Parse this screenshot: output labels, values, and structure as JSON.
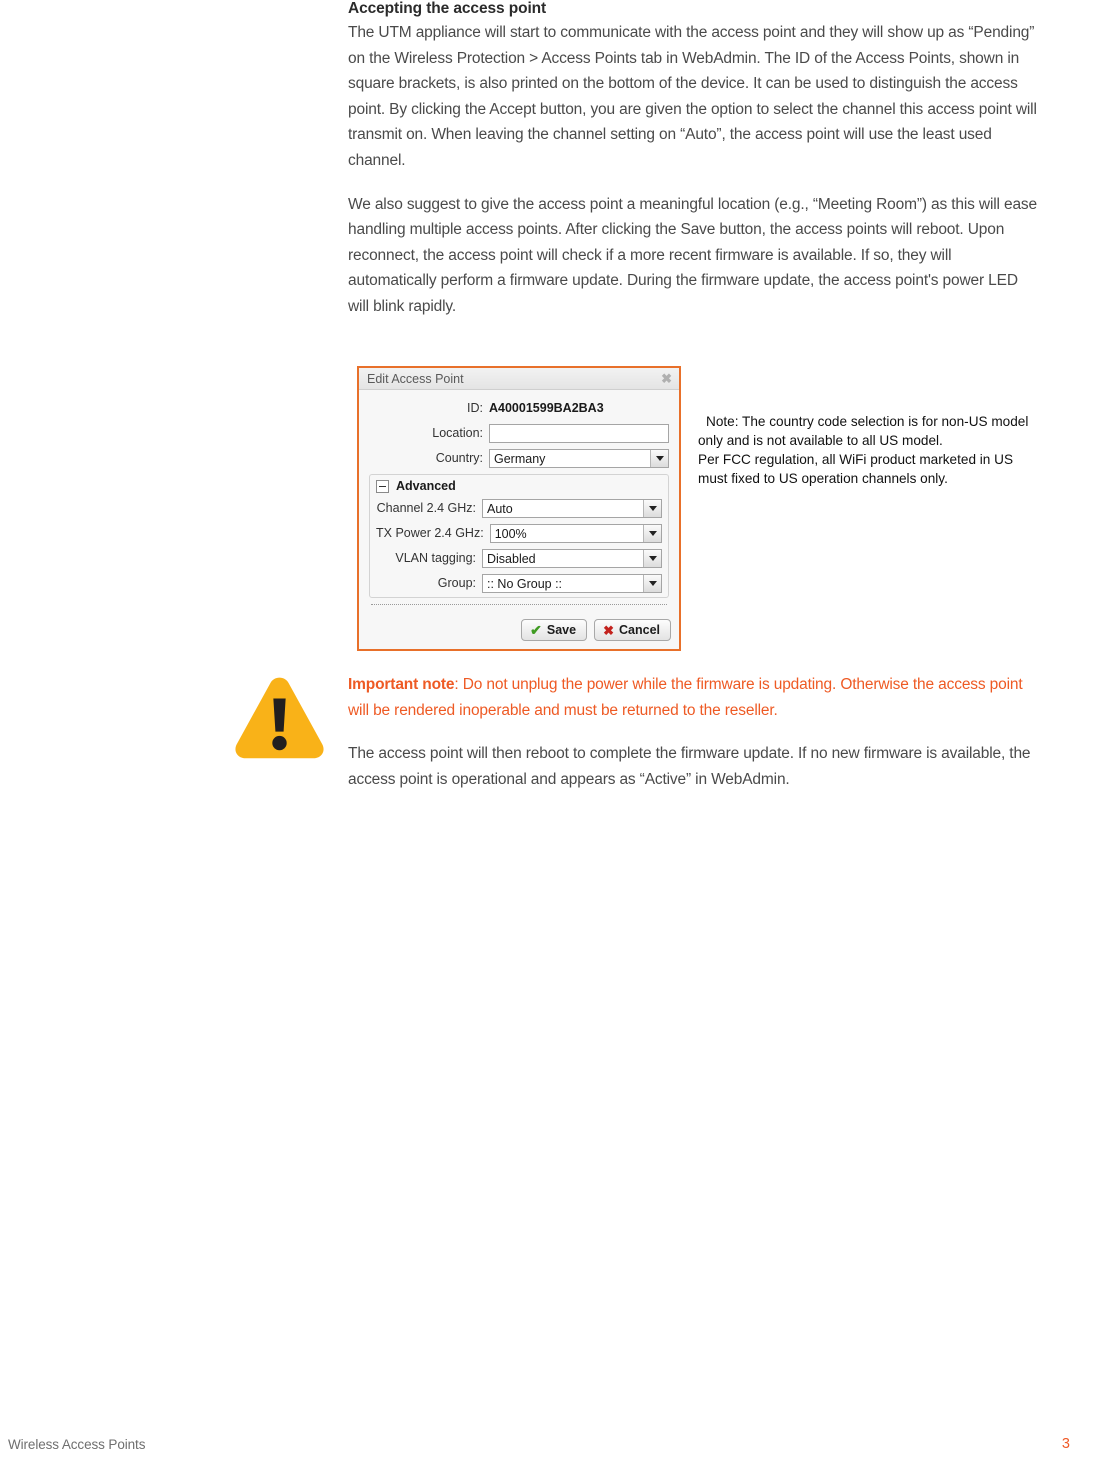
{
  "document": {
    "heading": "Accepting the access point",
    "paragraphs": [
      "The UTM appliance will start to communicate with the access point and they will show up as “Pending” on the Wireless Protection > Access Points tab in WebAdmin. The ID of the Access Points, shown in square brackets, is also printed on the bottom of the device. It can be used to distinguish the access point. By clicking the Accept button, you are given the option to select the channel this access point will transmit on. When leaving the channel setting on “Auto”, the access point will use the least used channel.",
      "We also suggest to give the access point a meaningful location (e.g., “Meeting Room”) as this will ease handling multiple access points. After clicking the Save button, the access points will reboot. Upon reconnect, the access point will check if a more recent firmware is available. If so, they will automatically perform a firmware update. During the firmware update, the access point's power LED will blink rapidly."
    ],
    "closing_paragraph": "The access point will then reboot to complete the firmware update. If no new firmware is available, the access point is operational and appears as “Active” in WebAdmin."
  },
  "dialog": {
    "title": "Edit Access Point",
    "close_icon": "✖",
    "fields": {
      "id_label": "ID:",
      "id_value": "A40001599BA2BA3",
      "location_label": "Location:",
      "location_value": "",
      "location_placeholder": "",
      "country_label": "Country:",
      "country_value": "Germany"
    },
    "advanced": {
      "title": "Advanced",
      "collapse_state": "expanded",
      "rows": [
        {
          "label": "Channel 2.4 GHz:",
          "value": "Auto"
        },
        {
          "label": "TX Power 2.4 GHz:",
          "value": "100%"
        },
        {
          "label": "VLAN tagging:",
          "value": "Disabled"
        },
        {
          "label": "Group:",
          "value": ":: No Group ::"
        }
      ]
    },
    "buttons": {
      "save_label": "Save",
      "save_icon": "✔",
      "cancel_label": "Cancel",
      "cancel_icon": "✖"
    },
    "border_color": "#e8702a"
  },
  "side_note": {
    "line1": "Note: The country code selection is for non-US model",
    "line2": "only and is not available to all US model.",
    "line3": "Per FCC regulation, all WiFi product marketed in US",
    "line4": "must fixed to US operation channels only."
  },
  "important_note": {
    "icon": "warning-triangle-icon",
    "label": "Important note",
    "body": ": Do not unplug the power while the firmware is updating. Otherwise the access point will be rendered inoperable and must be returned to the reseller.",
    "accent_color": "#ee5a24",
    "icon_color": "#f9b218"
  },
  "footer": {
    "left_text": "Wireless Access Points",
    "page_number": "3",
    "page_number_color": "#f05a28"
  }
}
